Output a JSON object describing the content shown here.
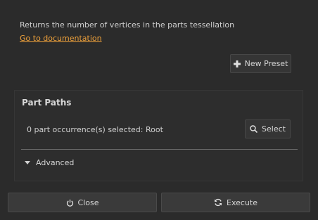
{
  "description": "Returns the number of vertices in the parts tessellation",
  "doc_link": "Go to documentation",
  "new_preset_label": "New Preset",
  "panel": {
    "title": "Part Paths",
    "selection_text": "0 part occurrence(s) selected: Root",
    "select_label": "Select",
    "advanced_label": "Advanced"
  },
  "footer": {
    "close_label": "Close",
    "execute_label": "Execute"
  },
  "colors": {
    "background": "#2b2b2b",
    "link": "#f0a23b",
    "button": "#353535"
  },
  "icons": {
    "new_preset": "plus-icon",
    "select": "search-icon",
    "advanced": "triangle-down-icon",
    "close": "power-icon",
    "execute": "refresh-icon"
  }
}
